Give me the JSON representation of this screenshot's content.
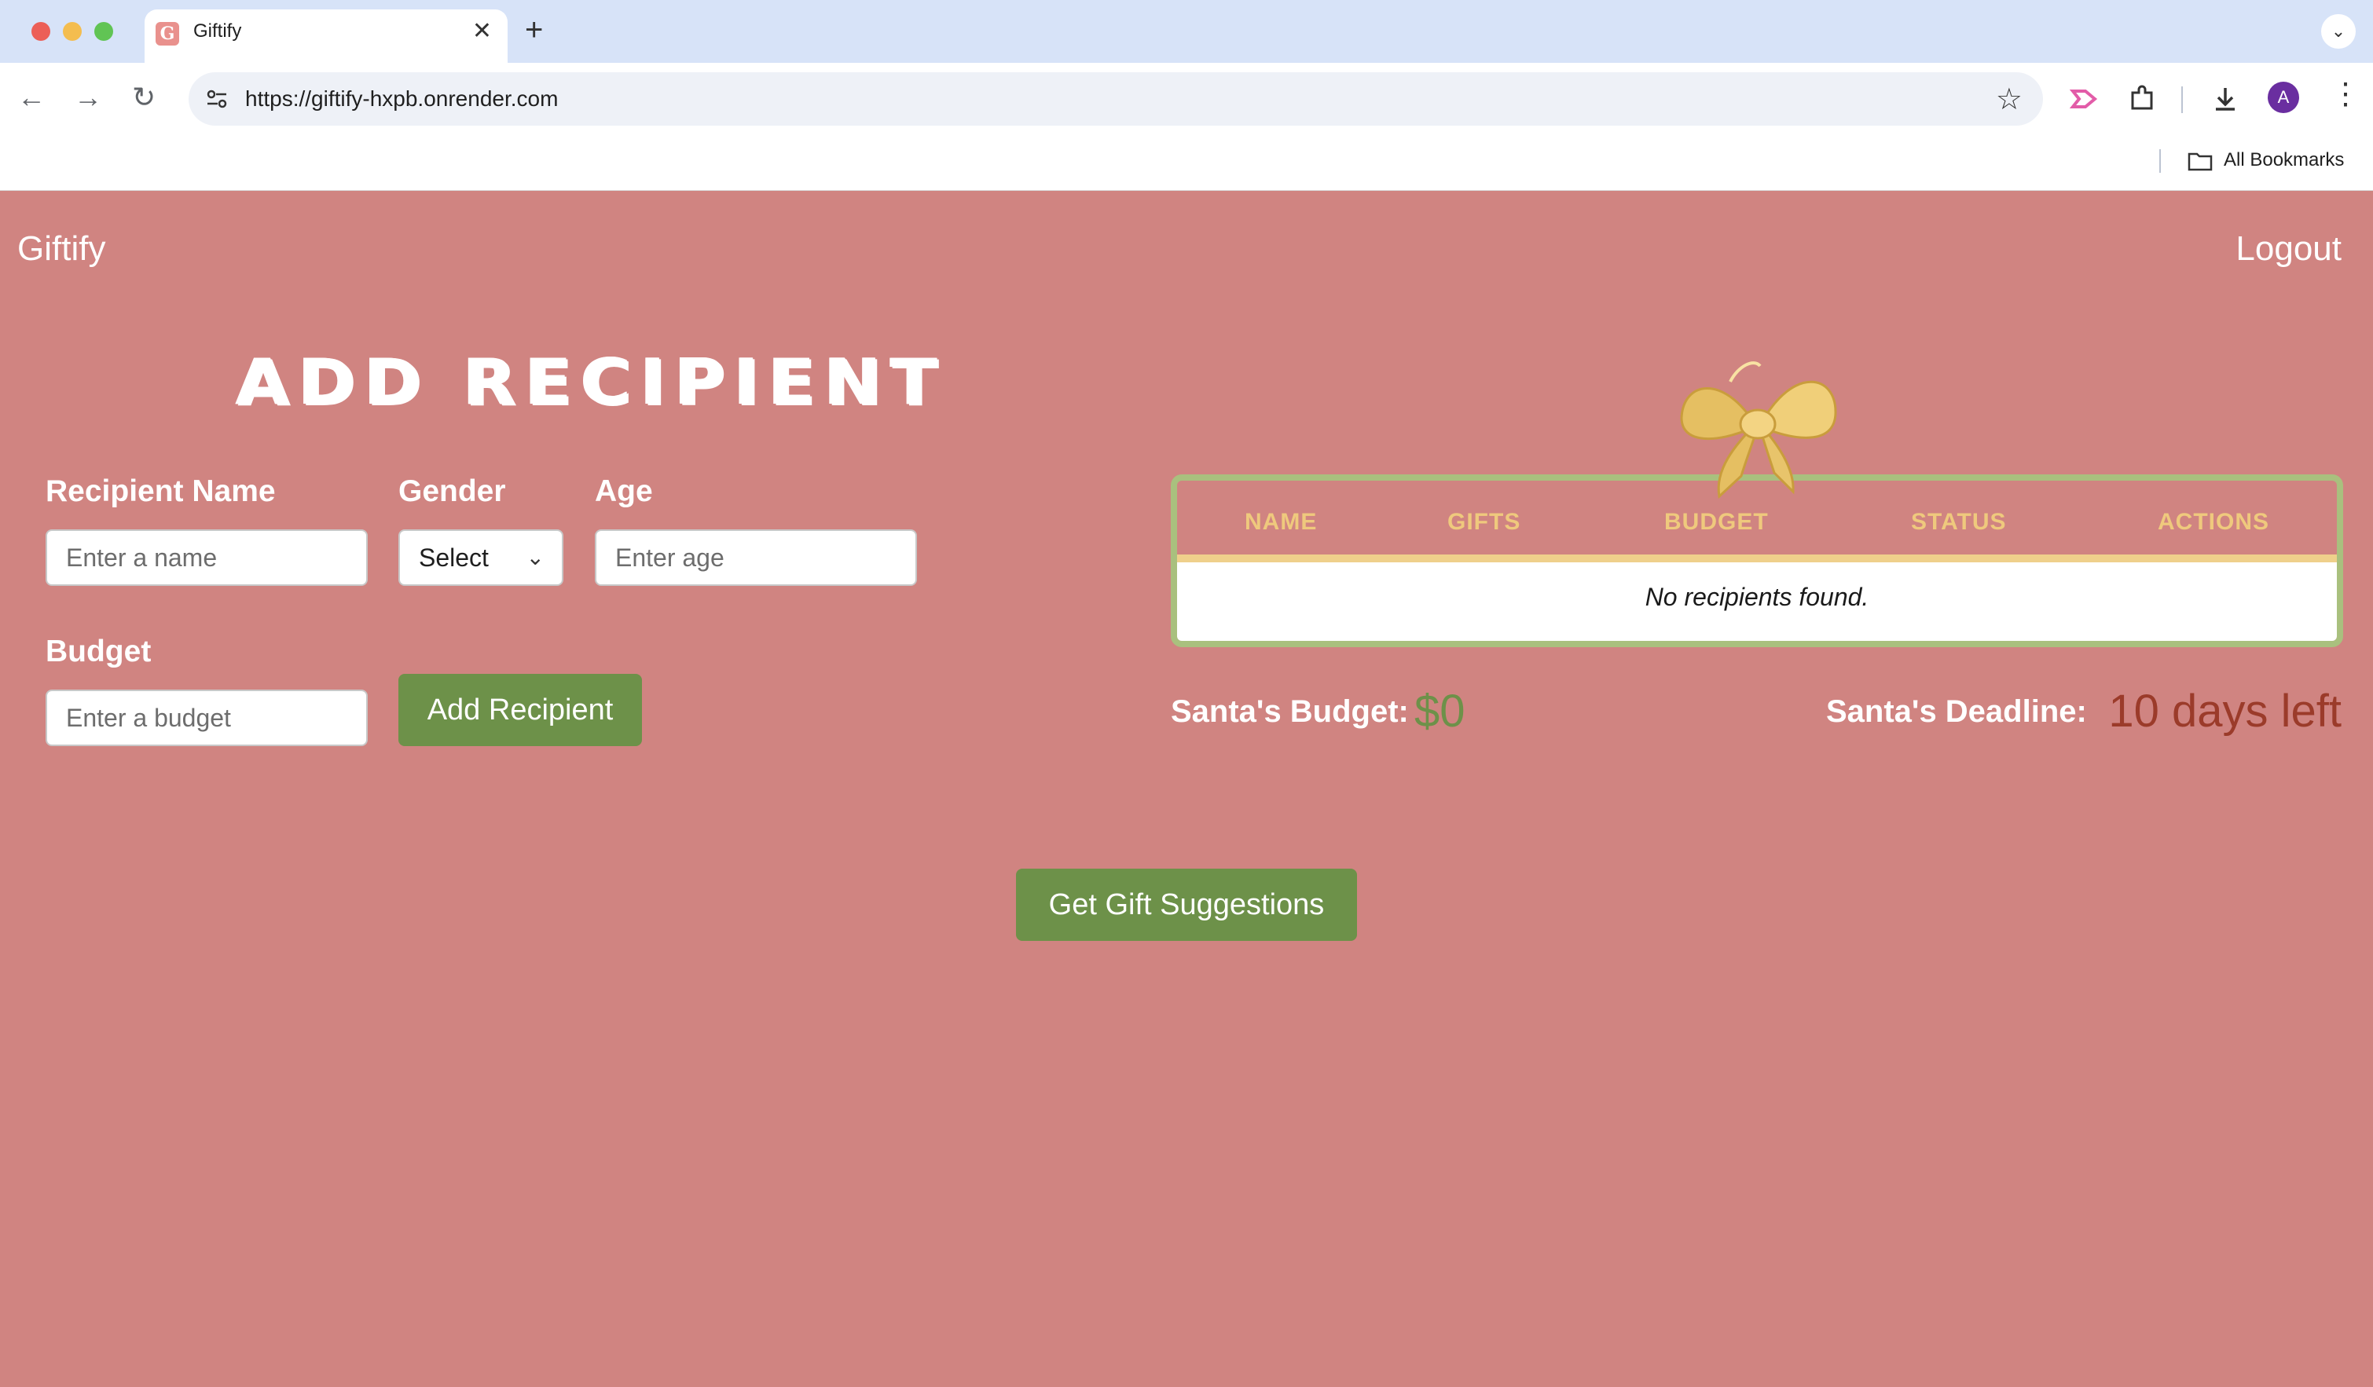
{
  "browser": {
    "tab_title": "Giftify",
    "tab_favicon_letter": "G",
    "url": "https://giftify-hxpb.onrender.com",
    "bookmarks_label": "All Bookmarks",
    "profile_initial": "A"
  },
  "header": {
    "brand": "Giftify",
    "logout_label": "Logout"
  },
  "form": {
    "title": "ADD RECIPIENT",
    "name_label": "Recipient Name",
    "name_placeholder": "Enter a name",
    "gender_label": "Gender",
    "gender_value": "Select",
    "age_label": "Age",
    "age_placeholder": "Enter age",
    "budget_label": "Budget",
    "budget_placeholder": "Enter a budget",
    "submit_label": "Add Recipient"
  },
  "table": {
    "columns": [
      "NAME",
      "GIFTS",
      "BUDGET",
      "STATUS",
      "ACTIONS"
    ],
    "empty_message": "No recipients found."
  },
  "summary": {
    "budget_label": "Santa's Budget:",
    "budget_value": "$0",
    "deadline_label": "Santa's Deadline:",
    "deadline_value": "10 days left"
  },
  "actions": {
    "suggestions_label": "Get Gift Suggestions"
  },
  "colors": {
    "page_bg": "#d08481",
    "button_green": "#6d9149",
    "table_border": "#a9c07e",
    "header_gold": "#efc97d",
    "deadline_red": "#9b3b2a"
  }
}
